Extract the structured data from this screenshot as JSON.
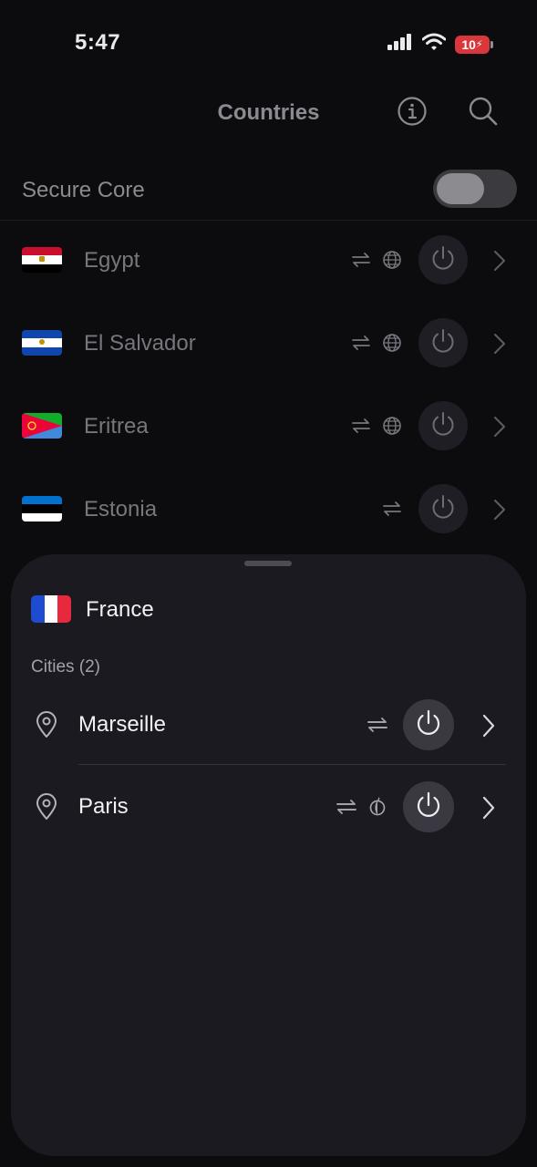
{
  "status_bar": {
    "time": "5:47",
    "battery": "10"
  },
  "header": {
    "title": "Countries",
    "info_icon": "info-circle-icon",
    "search_icon": "search-icon"
  },
  "secure_core": {
    "label": "Secure Core",
    "enabled": false
  },
  "countries": [
    {
      "name": "Egypt",
      "features": [
        "p2p-icon",
        "globe-icon"
      ]
    },
    {
      "name": "El Salvador",
      "features": [
        "p2p-icon",
        "globe-icon"
      ]
    },
    {
      "name": "Eritrea",
      "features": [
        "p2p-icon",
        "globe-icon"
      ]
    },
    {
      "name": "Estonia",
      "features": [
        "p2p-icon"
      ]
    }
  ],
  "sheet": {
    "country": "France",
    "cities_label": "Cities (2)",
    "cities": [
      {
        "name": "Marseille",
        "features": [
          "p2p-icon"
        ]
      },
      {
        "name": "Paris",
        "features": [
          "p2p-icon",
          "tor-icon"
        ]
      }
    ]
  },
  "colors": {
    "background": "#0c0c0f",
    "sheet": "#1b1a21",
    "muted_text": "#8b8a91",
    "primary_text": "#f2f2f4"
  }
}
